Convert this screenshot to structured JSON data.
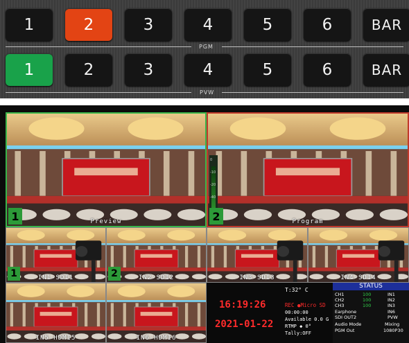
{
  "pgm": {
    "bus_label": "PGM",
    "buttons": [
      "1",
      "2",
      "3",
      "4",
      "5",
      "6",
      "BAR"
    ],
    "active_index": 1,
    "active_color": "#e34414"
  },
  "pvw": {
    "bus_label": "PVW",
    "buttons": [
      "1",
      "2",
      "3",
      "4",
      "5",
      "6",
      "BAR"
    ],
    "active_index": 0,
    "active_color": "#19a24a"
  },
  "multiview": {
    "preview": {
      "label": "Preview",
      "number": "1",
      "border_color": "#39b54a"
    },
    "program": {
      "label": "Program",
      "number": "2",
      "border_color": "#c0392b"
    },
    "inputs": [
      {
        "label": "IN1-SDI1",
        "number": "1"
      },
      {
        "label": "IN2-SDI2",
        "number": "2"
      },
      {
        "label": "IN3-SDI3",
        "number": ""
      },
      {
        "label": "IN4-SDI4",
        "number": ""
      },
      {
        "label": "IN5-HDMI5",
        "number": ""
      },
      {
        "label": "IN6-HDMI6",
        "number": ""
      }
    ],
    "meter_ticks": [
      "0",
      "-10",
      "-20",
      "-40"
    ]
  },
  "status_panel": {
    "time": "16:19:26",
    "date": "2021-01-22",
    "temperature": "T:32° C",
    "rec_text": "REC ●Micro SD",
    "rec_time": "00:00:00",
    "available": "Available 0.0  G",
    "rtmp": "RTMP ◆  0°",
    "tally": "Tally:OFF"
  },
  "status": {
    "title": "STATUS",
    "channels": [
      {
        "name": "CH1",
        "value": "100",
        "input": "IN1"
      },
      {
        "name": "CH2",
        "value": "100",
        "input": "IN2"
      },
      {
        "name": "CH3",
        "value": "100",
        "input": "IN3"
      }
    ],
    "earphone": {
      "label": "Earphone",
      "value": "IN6"
    },
    "sdi_out2": {
      "label": "SDI OUT2",
      "value": "PVW"
    },
    "audio_mode": {
      "label": "Audio Mode",
      "value": "Mixing"
    },
    "pgm_out": {
      "label": "PGM Out",
      "value": "1080P30"
    }
  }
}
